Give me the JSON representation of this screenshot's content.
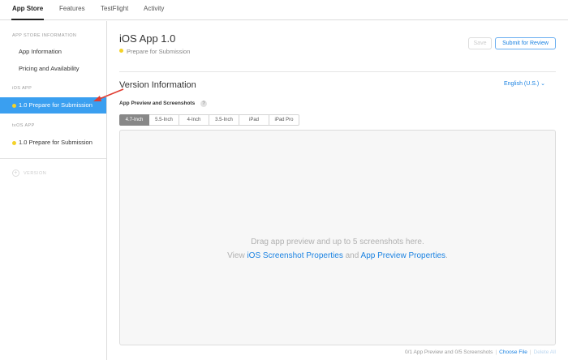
{
  "topnav": {
    "tabs": [
      "App Store",
      "Features",
      "TestFlight",
      "Activity"
    ],
    "active": "App Store"
  },
  "sidebar": {
    "section_app_info": "APP STORE INFORMATION",
    "item_app_information": "App Information",
    "item_pricing": "Pricing and Availability",
    "section_ios": "iOS APP",
    "ios_version": "1.0 Prepare for Submission",
    "section_tvos": "tvOS APP",
    "tvos_version": "1.0 Prepare for Submission",
    "add_version": "VERSION"
  },
  "header": {
    "title": "iOS App 1.0",
    "status": "Prepare for Submission",
    "save_label": "Save",
    "submit_label": "Submit for Review"
  },
  "version_info": {
    "title": "Version Information",
    "language": "English (U.S.) ⌄",
    "preview_label": "App Preview and Screenshots",
    "help": "?",
    "device_tabs": [
      "4.7-Inch",
      "5.5-Inch",
      "4-Inch",
      "3.5-Inch",
      "iPad",
      "iPad Pro"
    ],
    "active_device": "4.7-Inch"
  },
  "dropzone": {
    "line1": "Drag app preview and up to 5 screenshots here.",
    "view": "View ",
    "link1": "iOS Screenshot Properties",
    "and": " and ",
    "link2": "App Preview Properties",
    "period": "."
  },
  "footer": {
    "count": "0/1 App Preview and 0/5 Screenshots",
    "choose_file": "Choose File",
    "delete_all": "Delete All"
  },
  "colors": {
    "accent": "#1a82e2",
    "selected_bg": "#3a9ff0",
    "status_dot": "#f4d229",
    "arrow": "#e03c31"
  }
}
